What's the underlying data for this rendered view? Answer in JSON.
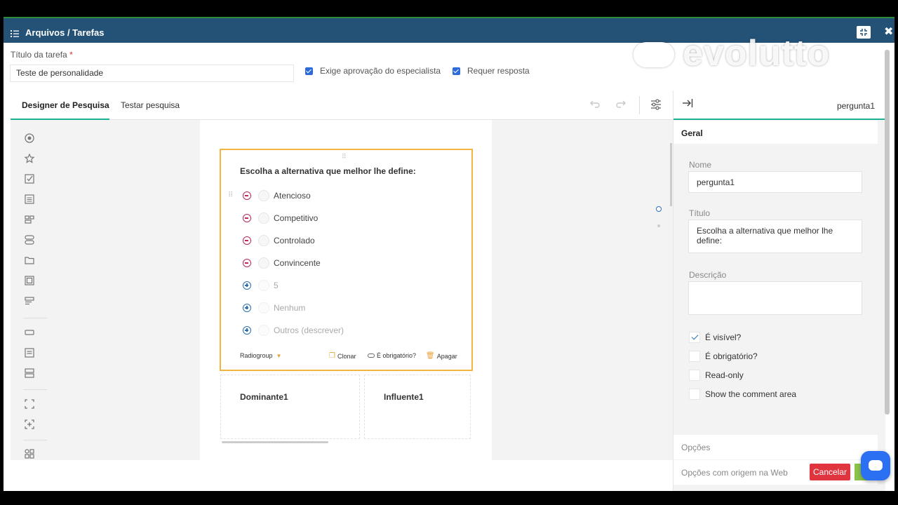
{
  "window": {
    "breadcrumb": "Arquivos / Tarefas",
    "close_glyph": "✖"
  },
  "brand": {
    "logo_text": "evolutto"
  },
  "task": {
    "label": "Título da tarefa",
    "required_mark": "*",
    "value": "Teste de personalidade",
    "approval_label": "Exige aprovação do especialista",
    "approval_checked": true,
    "reply_label": "Requer resposta",
    "reply_checked": true
  },
  "tabs": [
    {
      "label": "Designer de Pesquisa",
      "active": true
    },
    {
      "label": "Testar pesquisa",
      "active": false
    }
  ],
  "toolbar": {
    "undo_icon": "undo-icon",
    "redo_icon": "redo-icon",
    "settings_icon": "settings-icon"
  },
  "toolbox": [
    "radiogroup-icon",
    "rating-icon",
    "checkbox-icon",
    "dropdown-icon",
    "tagbox-icon",
    "boolean-icon",
    "file-icon",
    "imagepicker-icon",
    "ranking-icon",
    "text-icon",
    "comment-icon",
    "multipletext-icon",
    "panel-icon",
    "paneldynamic-icon",
    "matrix-icon"
  ],
  "question": {
    "title": "Escolha a alternativa que melhor lhe define:",
    "choices": [
      {
        "label": "Atencioso",
        "action": "minus"
      },
      {
        "label": "Competitivo",
        "action": "minus"
      },
      {
        "label": "Controlado",
        "action": "minus"
      },
      {
        "label": "Convincente",
        "action": "minus"
      }
    ],
    "extras": [
      {
        "label": "5"
      },
      {
        "label": "Nenhum"
      },
      {
        "label": "Outros (descrever)"
      }
    ],
    "type_label": "Radiogroup",
    "clone_label": "Clonar",
    "required_label": "É obrigatório?",
    "delete_label": "Apagar"
  },
  "next_questions": [
    {
      "title": "Dominante1"
    },
    {
      "title": "Influente1"
    }
  ],
  "properties": {
    "header_name": "pergunta1",
    "section_general": "Geral",
    "name_label": "Nome",
    "name_value": "pergunta1",
    "title_label": "Título",
    "title_value": "Escolha a alternativa que melhor lhe define:",
    "description_label": "Descrição",
    "description_value": "",
    "checkboxes": [
      {
        "label": "É visível?",
        "checked": true
      },
      {
        "label": "É obrigatório?",
        "checked": false
      },
      {
        "label": "Read-only",
        "checked": false
      },
      {
        "label": "Show the comment area",
        "checked": false
      }
    ],
    "section_options": "Opções",
    "section_web": "Opções com origem na Web"
  },
  "footer": {
    "cancel_label": "Cancelar"
  },
  "colors": {
    "topbar": "#245276",
    "accent": "#19b394",
    "selected": "#f3b53f",
    "cancel": "#e0343f",
    "minus": "#c0275a",
    "plus": "#2a70b8"
  }
}
